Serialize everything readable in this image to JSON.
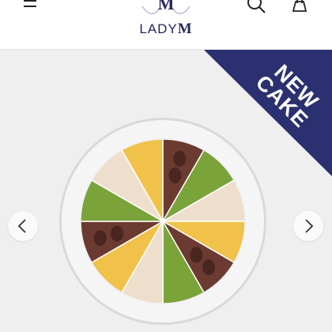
{
  "header": {
    "brand_part1": "LADY",
    "brand_part2": "M",
    "brand_monogram": "M"
  },
  "promo": {
    "badge_line1": "NEW",
    "badge_line2": "CAKE"
  },
  "colors": {
    "brand_navy": "#24275e",
    "banner_navy": "#2b3070",
    "background": "#efefef"
  },
  "icons": {
    "menu": "hamburger-menu-icon",
    "search": "search-icon",
    "bag": "shopping-bag-icon",
    "prev": "chevron-left-icon",
    "next": "chevron-right-icon"
  }
}
